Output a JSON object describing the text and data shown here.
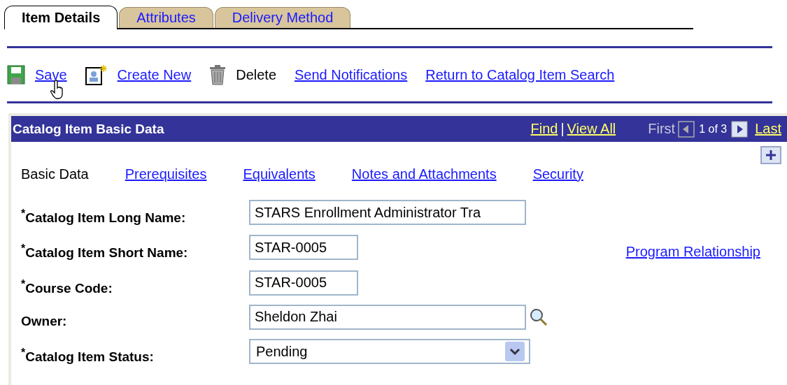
{
  "tabs": [
    {
      "label": "Item Details",
      "selected": true
    },
    {
      "label": "Attributes",
      "selected": false
    },
    {
      "label": "Delivery Method",
      "selected": false
    }
  ],
  "toolbar": [
    {
      "label": "Save",
      "kind": "save",
      "disabled": false
    },
    {
      "label": "Create New",
      "kind": "create",
      "disabled": false
    },
    {
      "label": "Delete",
      "kind": "delete",
      "disabled": true
    },
    {
      "label": "Send Notifications",
      "kind": "link",
      "disabled": false
    },
    {
      "label": "Return to Catalog Item Search",
      "kind": "link",
      "disabled": false
    }
  ],
  "panel": {
    "title": "Catalog Item Basic Data",
    "find": "Find",
    "separator": "|",
    "view_all": "View All",
    "first": "First",
    "counter": "1 of 3",
    "last": "Last",
    "subtabs": [
      {
        "label": "Basic Data",
        "selected": true
      },
      {
        "label": "Prerequisites",
        "selected": false
      },
      {
        "label": "Equivalents",
        "selected": false
      },
      {
        "label": "Notes and Attachments",
        "selected": false
      },
      {
        "label": "Security",
        "selected": false
      }
    ],
    "side_link": "Program Relationship",
    "fields": [
      {
        "label": "$^{*}$Catalog Item Long Name:",
        "value": "STARS Enrollment Administrator Tra",
        "kind": "long"
      },
      {
        "label": "$^{*}$Catalog Item Short Name:",
        "value": "STAR-0005",
        "kind": "short"
      },
      {
        "label": "$^{*}$Course Code:",
        "value": "STAR-0005",
        "kind": "short"
      },
      {
        "label": "Owner:",
        "value": "Sheldon Zhai",
        "kind": "lookup"
      },
      {
        "label": "$^{*}$Catalog Item Status:",
        "value": "Pending",
        "kind": "select"
      }
    ]
  }
}
